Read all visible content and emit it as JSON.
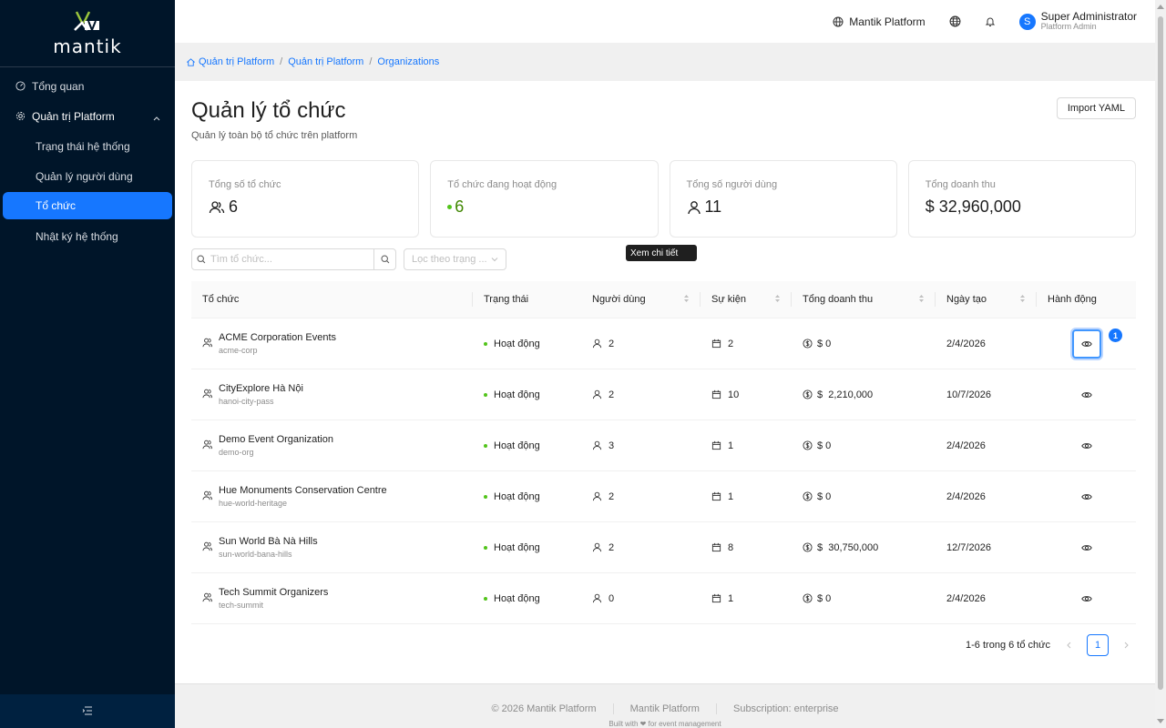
{
  "app": {
    "logo_text": "mantik"
  },
  "sidebar": {
    "items": [
      {
        "label": "Tổng quan",
        "icon": "dashboard-icon"
      },
      {
        "label": "Quản trị Platform",
        "icon": "gear-icon"
      }
    ],
    "subitems": [
      {
        "label": "Trạng thái hệ thống"
      },
      {
        "label": "Quản lý người dùng"
      },
      {
        "label": "Tổ chức",
        "active": true
      },
      {
        "label": "Nhật ký hệ thống"
      }
    ]
  },
  "header": {
    "platform": "Mantik Platform",
    "user_name": "Super Administrator",
    "user_role": "Platform Admin",
    "avatar_letter": "S"
  },
  "breadcrumb": [
    "Quản trị Platform",
    "Quản trị Platform",
    "Organizations"
  ],
  "page": {
    "title": "Quản lý tổ chức",
    "subtitle": "Quản lý toàn bộ tổ chức trên platform",
    "import_label": "Import YAML"
  },
  "stats": [
    {
      "label": "Tổng số tổ chức",
      "value": "6"
    },
    {
      "label": "Tổ chức đang hoạt động",
      "value": "6"
    },
    {
      "label": "Tổng số người dùng",
      "value": "11"
    },
    {
      "label": "Tổng doanh thu",
      "value": "$ 32,960,000"
    }
  ],
  "filters": {
    "search_placeholder": "Tìm tổ chức...",
    "status_placeholder": "Lọc theo trạng ..."
  },
  "table": {
    "columns": [
      "Tổ chức",
      "Trạng thái",
      "Người dùng",
      "Sự kiện",
      "Tổng doanh thu",
      "Ngày tạo",
      "Hành động"
    ],
    "rows": [
      {
        "name": "ACME Corporation Events",
        "slug": "acme-corp",
        "status": "Hoạt động",
        "users": "2",
        "events": "2",
        "revenue": "$ 0",
        "created": "2/4/2026"
      },
      {
        "name": "CityExplore Hà Nội",
        "slug": "hanoi-city-pass",
        "status": "Hoạt động",
        "users": "2",
        "events": "10",
        "revenue": "$  2,210,000",
        "created": "10/7/2026"
      },
      {
        "name": "Demo Event Organization",
        "slug": "demo-org",
        "status": "Hoạt động",
        "users": "3",
        "events": "1",
        "revenue": "$ 0",
        "created": "2/4/2026"
      },
      {
        "name": "Hue Monuments Conservation Centre",
        "slug": "hue-world-heritage",
        "status": "Hoạt động",
        "users": "2",
        "events": "1",
        "revenue": "$ 0",
        "created": "2/4/2026"
      },
      {
        "name": "Sun World Bà Nà Hills",
        "slug": "sun-world-bana-hills",
        "status": "Hoạt động",
        "users": "2",
        "events": "8",
        "revenue": "$  30,750,000",
        "created": "12/7/2026"
      },
      {
        "name": "Tech Summit Organizers",
        "slug": "tech-summit",
        "status": "Hoạt động",
        "users": "0",
        "events": "1",
        "revenue": "$ 0",
        "created": "2/4/2026"
      }
    ]
  },
  "tooltip": "Xem chi tiết",
  "badge": "1",
  "pagination": {
    "summary": "1-6 trong 6 tổ chức",
    "current": "1"
  },
  "footer": {
    "copyright": "© 2026 Mantik Platform",
    "platform": "Mantik Platform",
    "subscription": "Subscription: enterprise",
    "built": "Built with ❤ for event management"
  },
  "colors": {
    "sidebar": "#001529",
    "accent": "#1677ff",
    "success": "#52c41a"
  }
}
